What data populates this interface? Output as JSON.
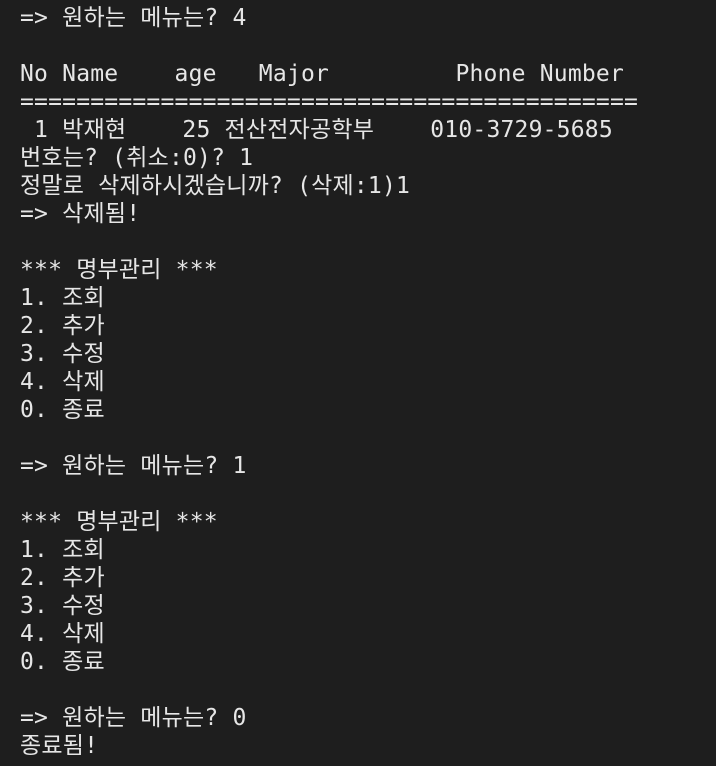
{
  "terminal": {
    "lines": [
      "=> 원하는 메뉴는? 4",
      "",
      "No Name    age   Major         Phone Number",
      "============================================",
      " 1 박재현    25 전산전자공학부    010-3729-5685",
      "번호는? (취소:0)? 1",
      "정말로 삭제하시겠습니까? (삭제:1)1",
      "=> 삭제됨!",
      "",
      "*** 명부관리 ***",
      "1. 조회",
      "2. 추가",
      "3. 수정",
      "4. 삭제",
      "0. 종료",
      "",
      "=> 원하는 메뉴는? 1",
      "",
      "*** 명부관리 ***",
      "1. 조회",
      "2. 추가",
      "3. 수정",
      "4. 삭제",
      "0. 종료",
      "",
      "=> 원하는 메뉴는? 0",
      "종료됨!"
    ]
  }
}
